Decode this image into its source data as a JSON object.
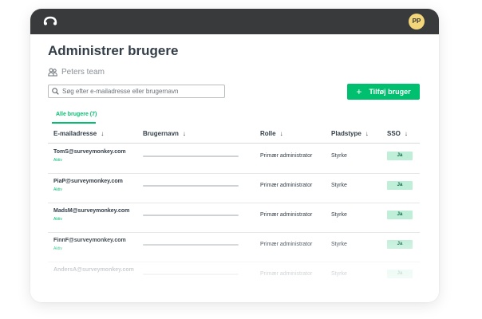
{
  "header": {
    "avatar_initials": "PP",
    "logo_icon": "surveymonkey-logo-icon",
    "bar_color": "#383a3c"
  },
  "page": {
    "title": "Administrer brugere",
    "team_icon": "team-icon",
    "team_name": "Peters team"
  },
  "search": {
    "placeholder": "Søg efter e-mailadresse eller brugernavn",
    "value": ""
  },
  "actions": {
    "add_user_label": "Tilføj bruger",
    "add_icon": "plus-icon",
    "accent_color": "#00bf6f"
  },
  "tabs": [
    {
      "label": "Alle brugere (7)",
      "active": true
    }
  ],
  "table": {
    "columns": [
      {
        "label": "E-mailadresse",
        "sort_icon": "arrow-down-icon"
      },
      {
        "label": "Brugernavn",
        "sort_icon": "arrow-down-icon"
      },
      {
        "label": "Rolle",
        "sort_icon": "arrow-down-icon"
      },
      {
        "label": "Pladstype",
        "sort_icon": "arrow-down-icon"
      },
      {
        "label": "SSO",
        "sort_icon": "arrow-down-icon"
      }
    ],
    "rows": [
      {
        "email": "TomS@surveymonkey.com",
        "status": "Aktiv",
        "role": "Primær administrator",
        "seat": "Styrke",
        "sso": "Ja"
      },
      {
        "email": "PiaP@surveymonkey.com",
        "status": "Aktiv",
        "role": "Primær administrator",
        "seat": "Styrke",
        "sso": "Ja"
      },
      {
        "email": "MadsM@surveymonkey.com",
        "status": "Aktiv",
        "role": "Primær administrator",
        "seat": "Styrke",
        "sso": "Ja"
      },
      {
        "email": "FinnF@surveymonkey.com",
        "status": "Aktiv",
        "role": "Primær administrator",
        "seat": "Styrke",
        "sso": "Ja"
      },
      {
        "email": "AndersA@surveymonkey.com",
        "status": "",
        "role": "Primær administrator",
        "seat": "Styrke",
        "sso": "Ja"
      }
    ]
  }
}
